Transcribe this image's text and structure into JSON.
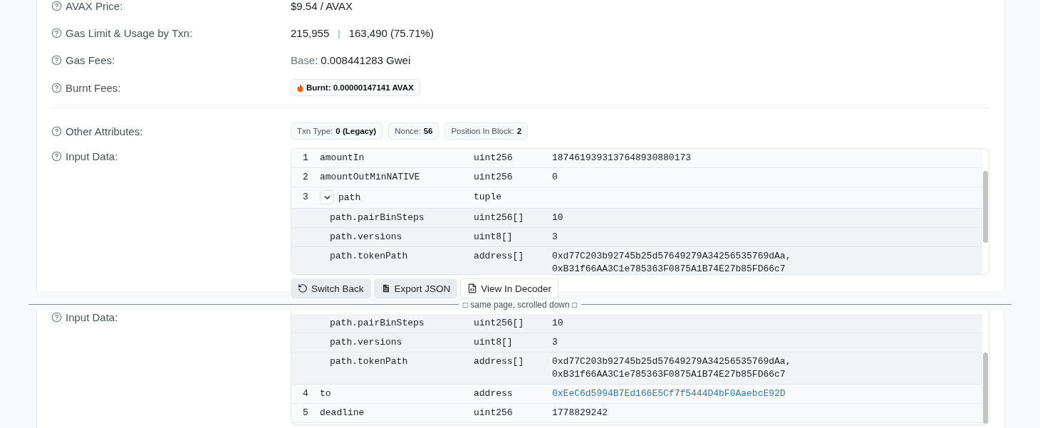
{
  "top_view": {
    "fields": [
      {
        "kind": "text",
        "label": "AVAX Price:",
        "value": "$9.54 / AVAX"
      },
      {
        "kind": "gas",
        "label": "Gas Limit & Usage by Txn:",
        "gas_limit": "215,955",
        "separator": "|",
        "usage": "163,490 (75.71%)"
      },
      {
        "kind": "base",
        "label": "Gas Fees:",
        "prefix": "Base:",
        "value": "0.008441283 Gwei"
      },
      {
        "kind": "burnt",
        "label": "Burnt Fees:",
        "badge": "Burnt: 0.00000147141 AVAX"
      },
      {
        "kind": "rule"
      },
      {
        "kind": "badges",
        "label": "Other Attributes:",
        "badges": [
          {
            "label": "Txn Type:",
            "value": "0 (Legacy)"
          },
          {
            "label": "Nonce:",
            "value": "56"
          },
          {
            "label": "Position In Block:",
            "value": "2"
          }
        ]
      }
    ],
    "input_data": {
      "label": "Input Data:",
      "rows": [
        {
          "kind": "param",
          "index": "1",
          "name": "amountIn",
          "type": "uint256",
          "value": [
            "1874619393137648930880173"
          ]
        },
        {
          "kind": "param",
          "index": "2",
          "name": "amountOutMinNATIVE",
          "type": "uint256",
          "value": [
            "0"
          ]
        },
        {
          "kind": "tuple",
          "index": "3",
          "name": "path",
          "type": "tuple",
          "expanded": true
        },
        {
          "kind": "component",
          "name": "path.pairBinSteps",
          "type": "uint256[]",
          "value": [
            "10"
          ]
        },
        {
          "kind": "component",
          "name": "path.versions",
          "type": "uint8[]",
          "value": [
            "3"
          ]
        },
        {
          "kind": "component",
          "name": "path.tokenPath",
          "type": "address[]",
          "value": [
            "0xd77C203b92745b25d57649279A34256535769dAa,",
            "0xB31f66AA3C1e785363F0875A1B74E27b85FD66c7"
          ]
        }
      ],
      "buttons": [
        {
          "kind": "switch",
          "label": "Switch Back"
        },
        {
          "kind": "export",
          "label": "Export JSON"
        },
        {
          "kind": "decoder",
          "label": "View In Decoder"
        }
      ]
    }
  },
  "divider": {
    "note": "□ same page, scrolled down □"
  },
  "bottom_view": {
    "input_data": {
      "label": "Input Data:",
      "rows": [
        {
          "kind": "component",
          "name": "path.pairBinSteps",
          "type": "uint256[]",
          "value": [
            "10"
          ]
        },
        {
          "kind": "component",
          "name": "path.versions",
          "type": "uint8[]",
          "value": [
            "3"
          ]
        },
        {
          "kind": "component",
          "name": "path.tokenPath",
          "type": "address[]",
          "value": [
            "0xd77C203b92745b25d57649279A34256535769dAa,",
            "0xB31f66AA3C1e785363F0875A1B74E27b85FD66c7"
          ]
        },
        {
          "kind": "link",
          "index": "4",
          "name": "to",
          "type": "address",
          "value": [
            "0xEeC6d5994B7Ed166E5Cf7f5444D4bF0AaebcE92D"
          ]
        },
        {
          "kind": "param",
          "index": "5",
          "name": "deadline",
          "type": "uint256",
          "value": [
            "1778829242"
          ]
        }
      ]
    }
  }
}
